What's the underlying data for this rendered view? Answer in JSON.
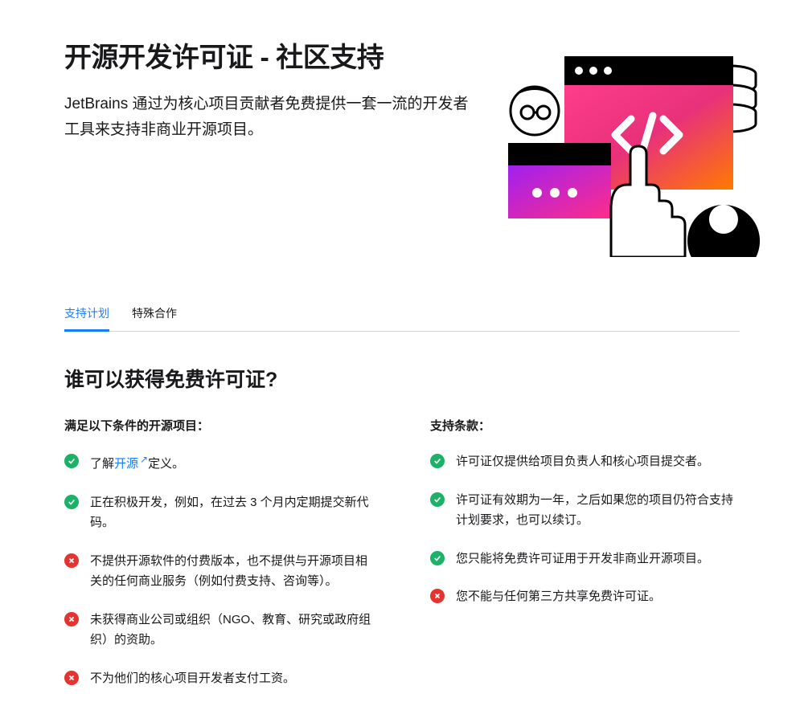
{
  "hero": {
    "title": "开源开发许可证 - 社区支持",
    "subtitle": "JetBrains 通过为核心项目贡献者免费提供一套一流的开发者工具来支持非商业开源项目。"
  },
  "tabs": [
    {
      "label": "支持计划",
      "active": true
    },
    {
      "label": "特殊合作",
      "active": false
    }
  ],
  "section_heading": "谁可以获得免费许可证?",
  "left": {
    "heading": "满足以下条件的开源项目：",
    "items": [
      {
        "icon": "check",
        "prefix": "了解",
        "link_text": "开源",
        "suffix": "定义。"
      },
      {
        "icon": "check",
        "text": "正在积极开发，例如，在过去 3 个月内定期提交新代码。"
      },
      {
        "icon": "cross",
        "text": "不提供开源软件的付费版本，也不提供与开源项目相关的任何商业服务（例如付费支持、咨询等）。"
      },
      {
        "icon": "cross",
        "text": "未获得商业公司或组织（NGO、教育、研究或政府组织）的资助。"
      },
      {
        "icon": "cross",
        "text": "不为他们的核心项目开发者支付工资。"
      }
    ]
  },
  "right": {
    "heading": "支持条款：",
    "items": [
      {
        "icon": "check",
        "text": "许可证仅提供给项目负责人和核心项目提交者。"
      },
      {
        "icon": "check",
        "text": "许可证有效期为一年，之后如果您的项目仍符合支持计划要求，也可以续订。"
      },
      {
        "icon": "check",
        "text": "您只能将免费许可证用于开发非商业开源项目。"
      },
      {
        "icon": "cross",
        "text": "您不能与任何第三方共享免费许可证。"
      }
    ]
  },
  "icons": {
    "check_name": "check-icon",
    "cross_name": "cross-icon"
  }
}
